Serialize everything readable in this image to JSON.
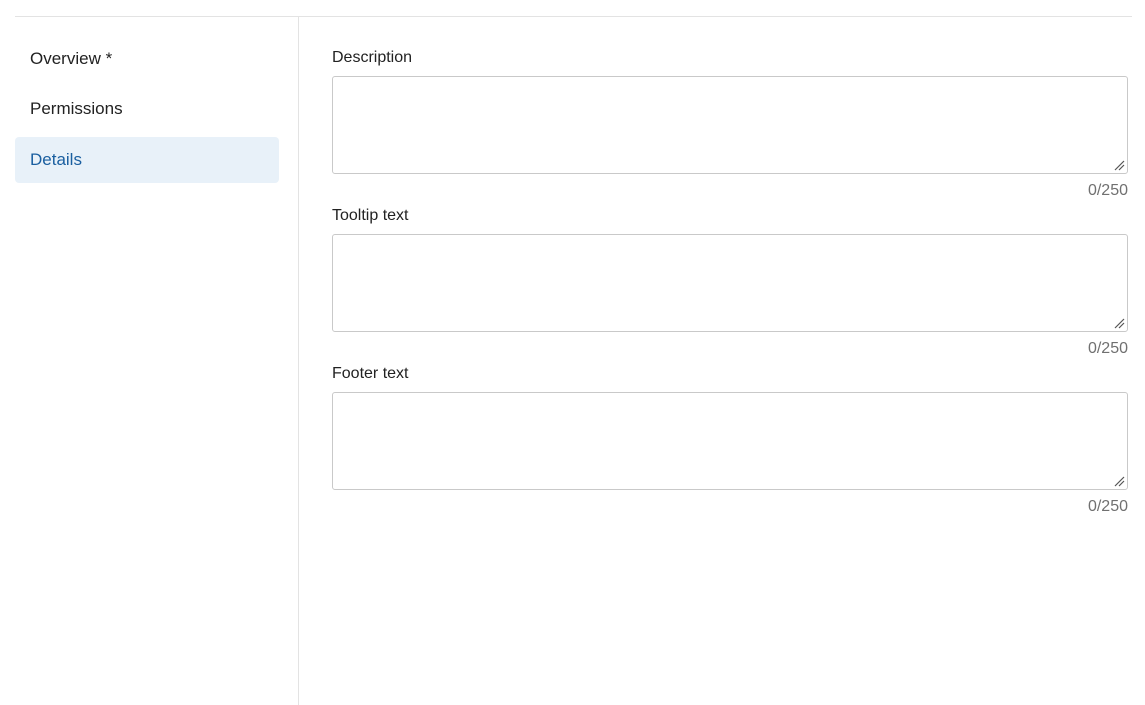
{
  "sidebar": {
    "items": [
      {
        "label": "Overview *",
        "active": false
      },
      {
        "label": "Permissions",
        "active": false
      },
      {
        "label": "Details",
        "active": true
      }
    ]
  },
  "fields": [
    {
      "label": "Description",
      "value": "",
      "counter": "0/250"
    },
    {
      "label": "Tooltip text",
      "value": "",
      "counter": "0/250"
    },
    {
      "label": "Footer text",
      "value": "",
      "counter": "0/250"
    }
  ],
  "colors": {
    "active_bg": "#e8f1f9",
    "active_text": "#1a5fa0",
    "border": "#c9c9c9",
    "counter_text": "#707070"
  }
}
